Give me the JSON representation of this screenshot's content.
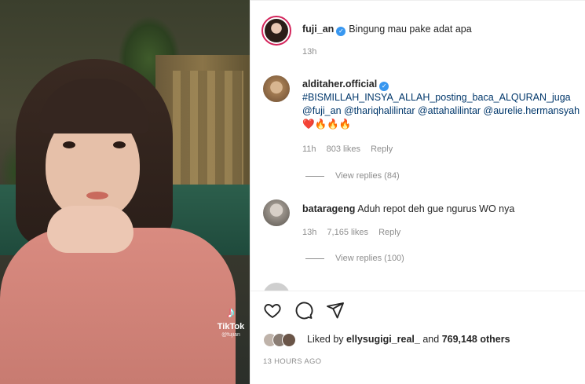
{
  "video": {
    "watermark_label": "TikTok",
    "watermark_handle": "@fujian",
    "watermark_icon": "tiktok-note-icon"
  },
  "caption": {
    "username": "fuji_an",
    "text": "Bingung mau pake adat apa",
    "time": "13h"
  },
  "comments": [
    {
      "username": "alditaher.official",
      "verified": true,
      "line1": "#BISMILLAH_INSYA_ALLAH_posting_baca_ALQURAN_juga",
      "line2": "@fuji_an @thariqhalilintar @attahalilintar @aurelie.hermansyah",
      "emoji": "❤️🔥🔥🔥",
      "time": "11h",
      "likes": "803 likes",
      "reply": "Reply",
      "view_replies": "View replies (84)"
    },
    {
      "username": "batarageng",
      "verified": false,
      "text": "Aduh repot deh gue ngurus WO nya",
      "time": "13h",
      "likes": "7,165 likes",
      "reply": "Reply",
      "view_replies": "View replies (100)"
    }
  ],
  "actions": {
    "like_icon": "heart-icon",
    "comment_icon": "comment-icon",
    "share_icon": "share-icon"
  },
  "likes_summary": {
    "prefix": "Liked by",
    "user": "ellysugigi_real_",
    "middle": "and",
    "count": "769,148 others"
  },
  "post_time": "13 HOURS AGO",
  "colors": {
    "story_ring": "#d3245b",
    "verified": "#3897f0",
    "link": "#00376b",
    "muted": "#8e8e8e"
  }
}
